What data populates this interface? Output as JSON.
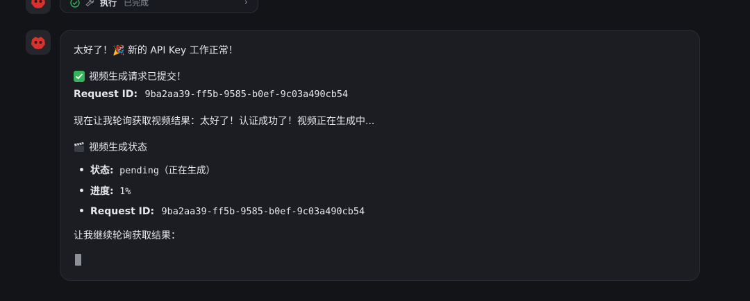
{
  "previous_tool": {
    "name": "执行",
    "status": "已完成",
    "icons": [
      "check-circle-icon",
      "wrench-icon",
      "chevron-right-icon"
    ]
  },
  "message": {
    "greeting": "太好了！🎉 新的 API Key 工作正常！",
    "submitted": "视频生成请求已提交！",
    "request_id_label": "Request ID:",
    "request_id_value": "9ba2aa39-ff5b-9585-b0ef-9c03a490cb54",
    "polling": "现在让我轮询获取视频结果：太好了！认证成功了！视频正在生成中...",
    "status_heading": "视频生成状态",
    "status_items": [
      {
        "label": "状态:",
        "value": "pending（正在生成）"
      },
      {
        "label": "进度:",
        "value": "1%"
      },
      {
        "label": "Request ID:",
        "value": "9ba2aa39-ff5b-9585-b0ef-9c03a490cb54"
      }
    ],
    "continue": "让我继续轮询获取结果："
  },
  "colors": {
    "background": "#121418",
    "bubble": "#1b1d22",
    "border": "#2a2d33",
    "success_green": "#33b35a",
    "avatar_red": "#d8322f"
  }
}
